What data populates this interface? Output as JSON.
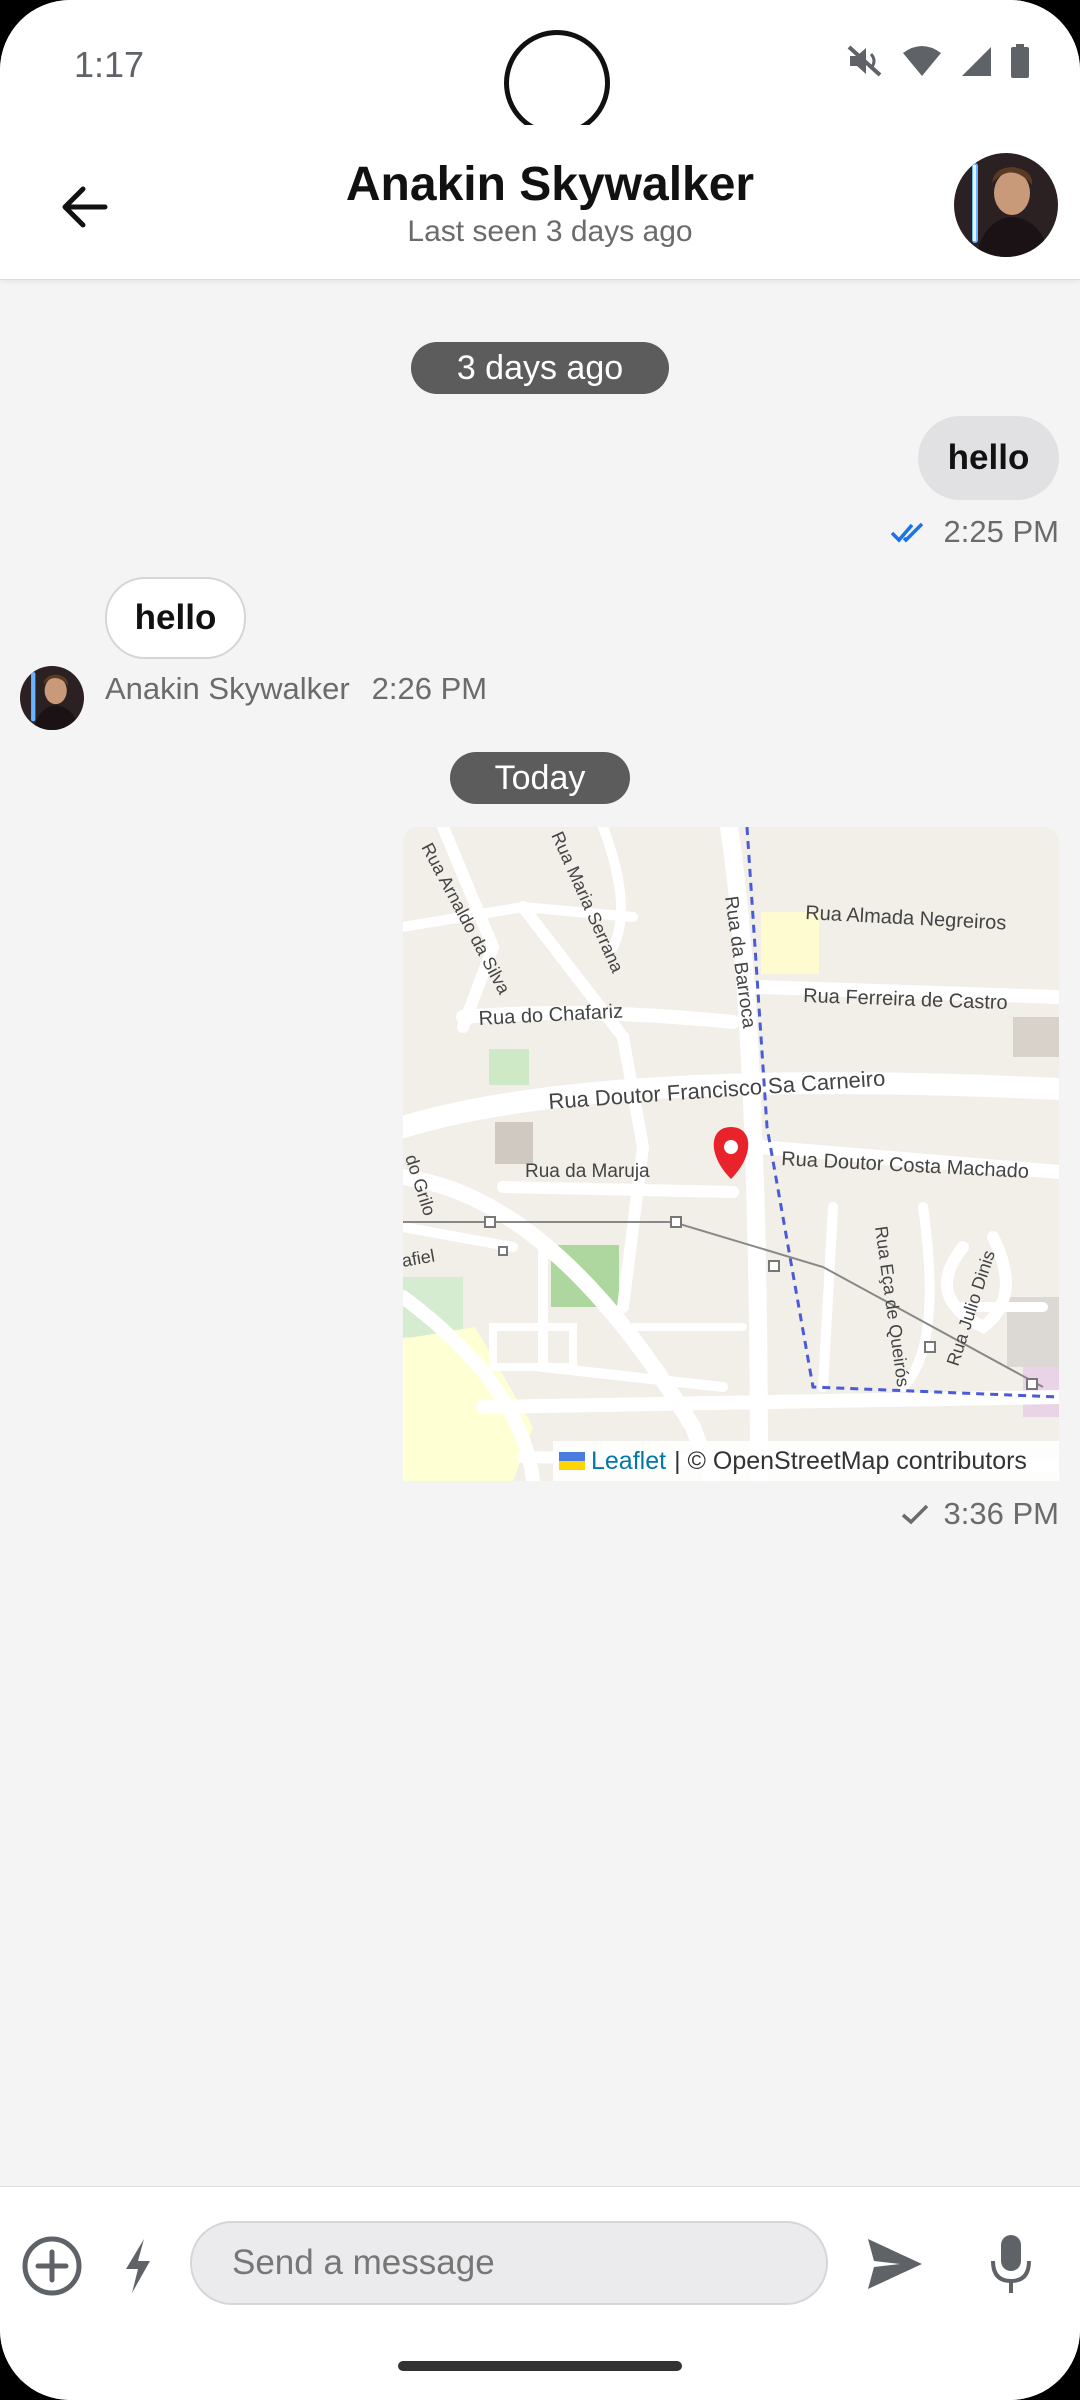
{
  "status_bar": {
    "time": "1:17"
  },
  "header": {
    "title": "Anakin Skywalker",
    "subtitle": "Last seen 3 days ago"
  },
  "messages": {
    "date1": "3 days ago",
    "out1_text": "hello",
    "out1_time": "2:25 PM",
    "in1_text": "hello",
    "in1_sender": "Anakin Skywalker",
    "in1_time": "2:26 PM",
    "date2": "Today",
    "map_time": "3:36 PM"
  },
  "map": {
    "streets": [
      "Rua Almada Negreiros",
      "Rua Ferreira de Castro",
      "Rua do Chafariz",
      "Rua Doutor Francisco Sa Carneiro",
      "Rua da Maruja",
      "Rua Doutor Costa Machado",
      "Rua da Barroca",
      "Rua Arnaldo da Silva",
      "Rua Maria Serrana",
      "Rua Eça de Queirós",
      "Rua Julio Dinis",
      "do Grilo",
      "afiel"
    ],
    "attribution_leaflet": "Leaflet",
    "attribution_rest": "| © OpenStreetMap contributors"
  },
  "composer": {
    "placeholder": "Send a message"
  },
  "colors": {
    "read_tick": "#1a73e8",
    "pin": "#e8232c"
  }
}
